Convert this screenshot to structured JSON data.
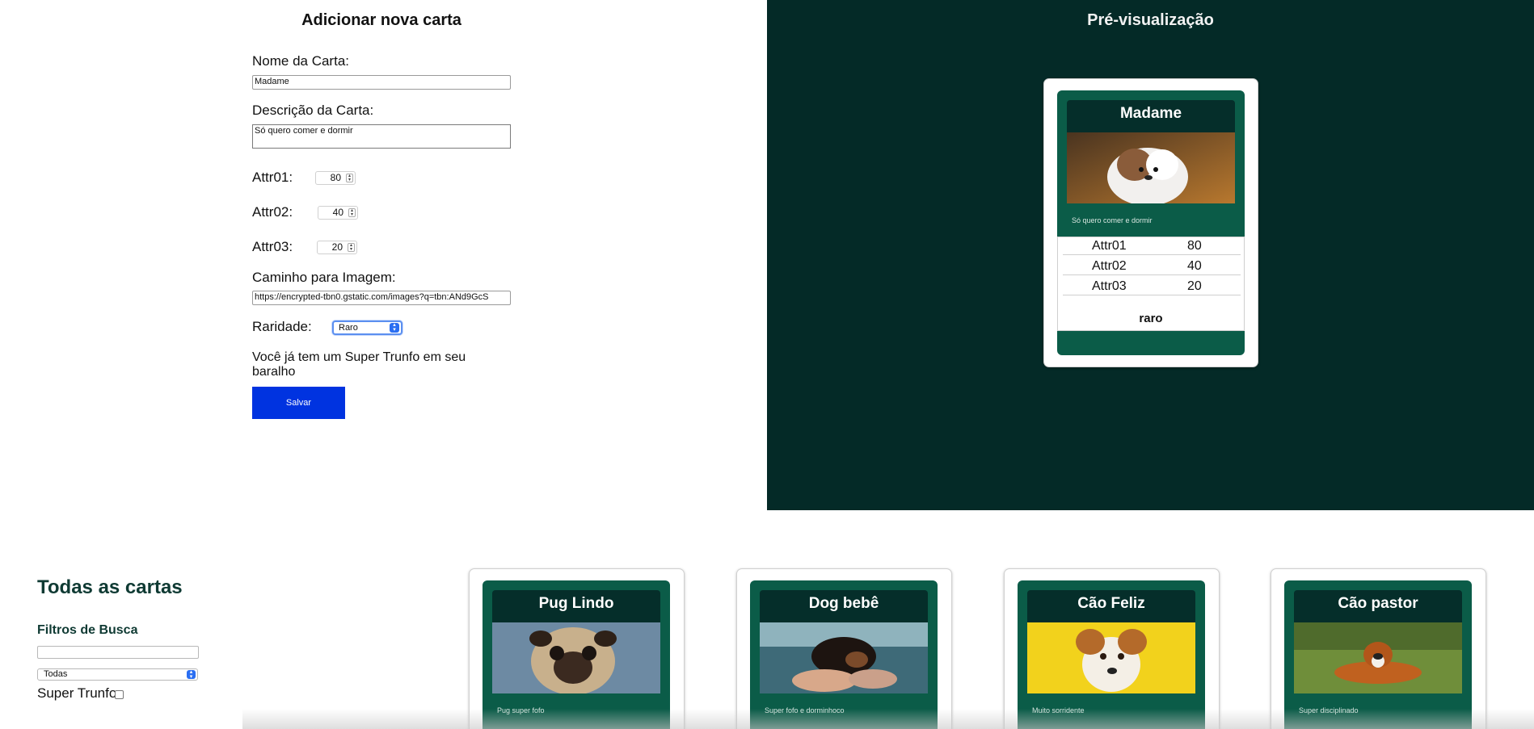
{
  "form": {
    "title": "Adicionar nova carta",
    "name_label": "Nome da Carta:",
    "name_value": "Madame",
    "description_label": "Descrição da Carta:",
    "description_value": "Só quero comer e dormir",
    "attr1_label": "Attr01:",
    "attr1_value": "80",
    "attr2_label": "Attr02:",
    "attr2_value": "40",
    "attr3_label": "Attr03:",
    "attr3_value": "20",
    "image_label": "Caminho para Imagem:",
    "image_value": "https://encrypted-tbn0.gstatic.com/images?q=tbn:ANd9GcS",
    "rarity_label": "Raridade:",
    "rarity_value": "Raro",
    "trunfo_message": "Você já tem um Super Trunfo em seu baralho",
    "save_label": "Salvar"
  },
  "preview": {
    "title": "Pré-visualização",
    "card": {
      "name": "Madame",
      "description": "Só quero comer e dormir",
      "attrs": [
        {
          "name": "Attr01",
          "value": "80"
        },
        {
          "name": "Attr02",
          "value": "40"
        },
        {
          "name": "Attr03",
          "value": "20"
        }
      ],
      "rarity": "raro"
    }
  },
  "all_cards": {
    "title": "Todas as cartas",
    "filters_title": "Filtros de Busca",
    "name_filter_value": "",
    "rarity_filter_value": "Todas",
    "trunfo_filter_label": "Super Trunfo",
    "cards": [
      {
        "name": "Pug Lindo",
        "description": "Pug super fofo"
      },
      {
        "name": "Dog bebê",
        "description": "Super fofo e dorminhoco"
      },
      {
        "name": "Cão Feliz",
        "description": "Muito sorridente"
      },
      {
        "name": "Cão pastor",
        "description": "Super disciplinado"
      }
    ]
  },
  "colors": {
    "preview_bg": "#042a27",
    "card_green": "#0b5c48",
    "card_header": "#052e2a",
    "save_button": "#0033e0",
    "heading_green": "#0f3a33"
  }
}
